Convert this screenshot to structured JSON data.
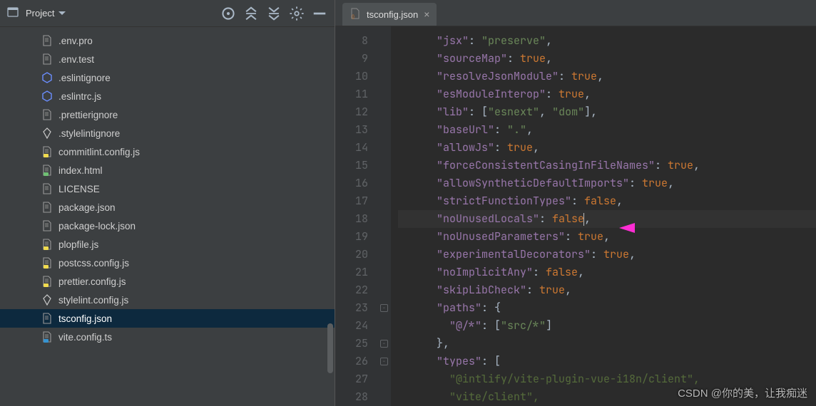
{
  "projectPanel": {
    "title": "Project",
    "files": [
      {
        "name": ".env.pro",
        "icon": "file"
      },
      {
        "name": ".env.test",
        "icon": "file"
      },
      {
        "name": ".eslintignore",
        "icon": "hex"
      },
      {
        "name": ".eslintrc.js",
        "icon": "hex"
      },
      {
        "name": ".prettierignore",
        "icon": "file"
      },
      {
        "name": ".stylelintignore",
        "icon": "style"
      },
      {
        "name": "commitlint.config.js",
        "icon": "js"
      },
      {
        "name": "index.html",
        "icon": "html"
      },
      {
        "name": "LICENSE",
        "icon": "file"
      },
      {
        "name": "package.json",
        "icon": "json"
      },
      {
        "name": "package-lock.json",
        "icon": "json"
      },
      {
        "name": "plopfile.js",
        "icon": "js"
      },
      {
        "name": "postcss.config.js",
        "icon": "js"
      },
      {
        "name": "prettier.config.js",
        "icon": "js"
      },
      {
        "name": "stylelint.config.js",
        "icon": "style"
      },
      {
        "name": "tsconfig.json",
        "icon": "json",
        "selected": true
      },
      {
        "name": "vite.config.ts",
        "icon": "ts"
      }
    ]
  },
  "editor": {
    "tabName": "tsconfig.json",
    "highlightLine": 18,
    "foldMarks": [
      23,
      25,
      26
    ],
    "lines": [
      {
        "n": 8,
        "t": [
          [
            "ind",
            "      "
          ],
          [
            "key",
            "\"jsx\""
          ],
          [
            "br",
            ": "
          ],
          [
            "str",
            "\"preserve\""
          ],
          [
            "br",
            ","
          ]
        ]
      },
      {
        "n": 9,
        "t": [
          [
            "ind",
            "      "
          ],
          [
            "key",
            "\"sourceMap\""
          ],
          [
            "br",
            ": "
          ],
          [
            "bool",
            "true"
          ],
          [
            "br",
            ","
          ]
        ]
      },
      {
        "n": 10,
        "t": [
          [
            "ind",
            "      "
          ],
          [
            "key",
            "\"resolveJsonModule\""
          ],
          [
            "br",
            ": "
          ],
          [
            "bool",
            "true"
          ],
          [
            "br",
            ","
          ]
        ]
      },
      {
        "n": 11,
        "t": [
          [
            "ind",
            "      "
          ],
          [
            "key",
            "\"esModuleInterop\""
          ],
          [
            "br",
            ": "
          ],
          [
            "bool",
            "true"
          ],
          [
            "br",
            ","
          ]
        ]
      },
      {
        "n": 12,
        "t": [
          [
            "ind",
            "      "
          ],
          [
            "key",
            "\"lib\""
          ],
          [
            "br",
            ": ["
          ],
          [
            "str",
            "\"esnext\""
          ],
          [
            "br",
            ", "
          ],
          [
            "str",
            "\"dom\""
          ],
          [
            "br",
            "],"
          ]
        ]
      },
      {
        "n": 13,
        "t": [
          [
            "ind",
            "      "
          ],
          [
            "key",
            "\"baseUrl\""
          ],
          [
            "br",
            ": "
          ],
          [
            "str",
            "\".\""
          ],
          [
            "br",
            ","
          ]
        ]
      },
      {
        "n": 14,
        "t": [
          [
            "ind",
            "      "
          ],
          [
            "key",
            "\"allowJs\""
          ],
          [
            "br",
            ": "
          ],
          [
            "bool",
            "true"
          ],
          [
            "br",
            ","
          ]
        ]
      },
      {
        "n": 15,
        "t": [
          [
            "ind",
            "      "
          ],
          [
            "key",
            "\"forceConsistentCasingInFileNames\""
          ],
          [
            "br",
            ": "
          ],
          [
            "bool",
            "true"
          ],
          [
            "br",
            ","
          ]
        ]
      },
      {
        "n": 16,
        "t": [
          [
            "ind",
            "      "
          ],
          [
            "key",
            "\"allowSyntheticDefaultImports\""
          ],
          [
            "br",
            ": "
          ],
          [
            "bool",
            "true"
          ],
          [
            "br",
            ","
          ]
        ]
      },
      {
        "n": 17,
        "t": [
          [
            "ind",
            "      "
          ],
          [
            "key",
            "\"strictFunctionTypes\""
          ],
          [
            "br",
            ": "
          ],
          [
            "bool",
            "false"
          ],
          [
            "br",
            ","
          ]
        ]
      },
      {
        "n": 18,
        "t": [
          [
            "ind",
            "      "
          ],
          [
            "key",
            "\"noUnusedLocals\""
          ],
          [
            "br",
            ": "
          ],
          [
            "bool",
            "false"
          ],
          [
            "caret",
            ""
          ],
          [
            "br",
            ","
          ]
        ]
      },
      {
        "n": 19,
        "t": [
          [
            "ind",
            "      "
          ],
          [
            "key",
            "\"noUnusedParameters\""
          ],
          [
            "br",
            ": "
          ],
          [
            "bool",
            "true"
          ],
          [
            "br",
            ","
          ]
        ]
      },
      {
        "n": 20,
        "t": [
          [
            "ind",
            "      "
          ],
          [
            "key",
            "\"experimentalDecorators\""
          ],
          [
            "br",
            ": "
          ],
          [
            "bool",
            "true"
          ],
          [
            "br",
            ","
          ]
        ]
      },
      {
        "n": 21,
        "t": [
          [
            "ind",
            "      "
          ],
          [
            "key",
            "\"noImplicitAny\""
          ],
          [
            "br",
            ": "
          ],
          [
            "bool",
            "false"
          ],
          [
            "br",
            ","
          ]
        ]
      },
      {
        "n": 22,
        "t": [
          [
            "ind",
            "      "
          ],
          [
            "key",
            "\"skipLibCheck\""
          ],
          [
            "br",
            ": "
          ],
          [
            "bool",
            "true"
          ],
          [
            "br",
            ","
          ]
        ]
      },
      {
        "n": 23,
        "t": [
          [
            "ind",
            "      "
          ],
          [
            "key",
            "\"paths\""
          ],
          [
            "br",
            ": {"
          ]
        ]
      },
      {
        "n": 24,
        "t": [
          [
            "ind",
            "        "
          ],
          [
            "key",
            "\"@/*\""
          ],
          [
            "br",
            ": ["
          ],
          [
            "str",
            "\"src/*\""
          ],
          [
            "br",
            "]"
          ]
        ]
      },
      {
        "n": 25,
        "t": [
          [
            "ind",
            "      "
          ],
          [
            "br",
            "},"
          ]
        ]
      },
      {
        "n": 26,
        "t": [
          [
            "ind",
            "      "
          ],
          [
            "key",
            "\"types\""
          ],
          [
            "br",
            ": ["
          ]
        ]
      },
      {
        "n": 27,
        "t": [
          [
            "ind",
            "        "
          ],
          [
            "dim",
            "\"@intlify/vite-plugin-vue-i18n/client\""
          ],
          [
            "dim",
            ","
          ]
        ]
      },
      {
        "n": 28,
        "t": [
          [
            "ind",
            "        "
          ],
          [
            "dim",
            "\"vite/client\""
          ],
          [
            "dim",
            ","
          ]
        ]
      }
    ]
  },
  "watermark": "CSDN @你的美，让我痴迷"
}
